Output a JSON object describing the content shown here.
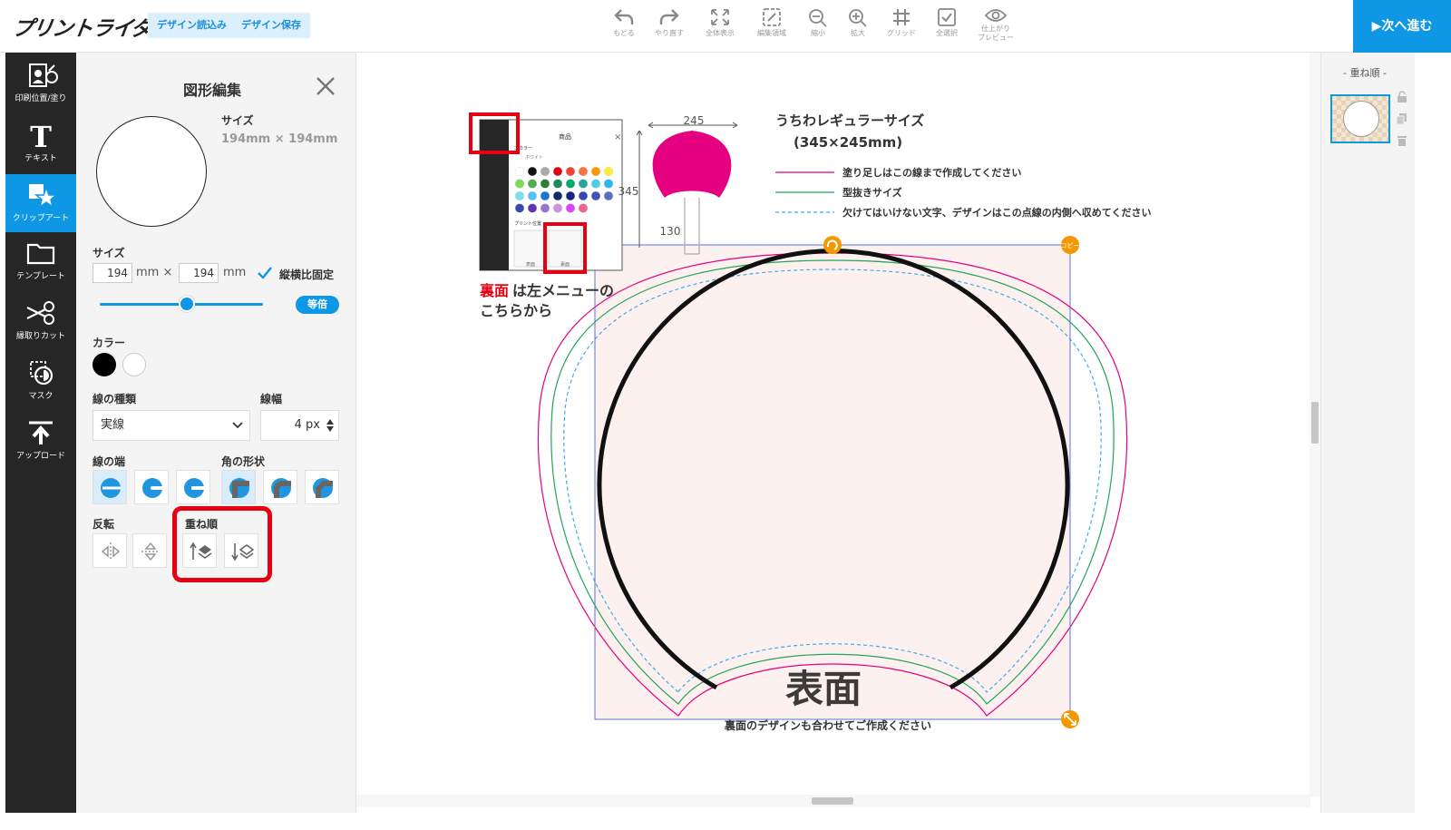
{
  "header": {
    "logo": "プリントライダー",
    "load_button": "デザイン読込み",
    "save_button": "デザイン保存",
    "tools": [
      {
        "label": "もどる",
        "icon": "undo-icon"
      },
      {
        "label": "やり直す",
        "icon": "redo-icon"
      },
      {
        "label": "全体表示",
        "icon": "fit-icon"
      },
      {
        "label": "編集領域",
        "icon": "edit-area-icon"
      },
      {
        "label": "縮小",
        "icon": "zoom-out-icon"
      },
      {
        "label": "拡大",
        "icon": "zoom-in-icon"
      },
      {
        "label": "グリッド",
        "icon": "grid-icon"
      },
      {
        "label": "全選択",
        "icon": "select-all-icon"
      },
      {
        "label": "仕上がり",
        "label2": "プレビュー",
        "icon": "eye-icon"
      }
    ],
    "next_button": "▶次へ進む"
  },
  "sidebar": {
    "items": [
      {
        "label": "印刷位置/塗り",
        "icon": "print-position-icon"
      },
      {
        "label": "テキスト",
        "icon": "text-icon"
      },
      {
        "label": "クリップアート",
        "icon": "clipart-icon",
        "active": true
      },
      {
        "label": "テンプレート",
        "icon": "folder-icon"
      },
      {
        "label": "縁取りカット",
        "icon": "scissors-icon"
      },
      {
        "label": "マスク",
        "icon": "mask-icon"
      },
      {
        "label": "アップロード",
        "icon": "upload-icon"
      }
    ]
  },
  "panel": {
    "title": "図形編集",
    "size_label": "サイズ",
    "size_value": "194mm × 194mm",
    "size_label2": "サイズ",
    "width": "194",
    "height": "194",
    "unit_mm_x": "mm ×",
    "unit_mm": "mm",
    "aspect_lock": "縦横比固定",
    "scale_pill": "等倍",
    "color_label": "カラー",
    "colors": [
      "#000000",
      "#ffffff"
    ],
    "line_type_label": "線の種類",
    "line_type_value": "実線",
    "line_width_label": "線幅",
    "line_width_value": "4 px",
    "line_end_label": "線の端",
    "corner_label": "角の形状",
    "flip_label": "反転",
    "order_label": "重ね順"
  },
  "canvas": {
    "tooltip_callout_line1_red": "裏面",
    "tooltip_callout_line1": "は左メニューの",
    "tooltip_callout_line2": "こちらから",
    "mini_panel": {
      "title": "商品",
      "color_label": "ニカラー",
      "white_label": "ホワイト",
      "print_label": "プリント位置",
      "front": "表面",
      "back": "裏面"
    },
    "dim_245": "245",
    "dim_345": "345",
    "dim_130": "130",
    "spec_title1": "うちわレギュラーサイズ",
    "spec_title2": "(345×245mm)",
    "legend": [
      {
        "text": "塗り足しはこの線まで作成してください",
        "color": "#e4007f"
      },
      {
        "text": "型抜きサイズ",
        "color": "#22a55a"
      },
      {
        "text": "欠けてはいけない文字、デザインはこの点線の内側へ収めてください",
        "color": "#3fa9f5"
      }
    ],
    "face_label": "表面",
    "back_note": "裏面のデザインも合わせてご作成ください",
    "copy_badge": "コピー"
  },
  "layers": {
    "title": "- 重ね順 -"
  }
}
